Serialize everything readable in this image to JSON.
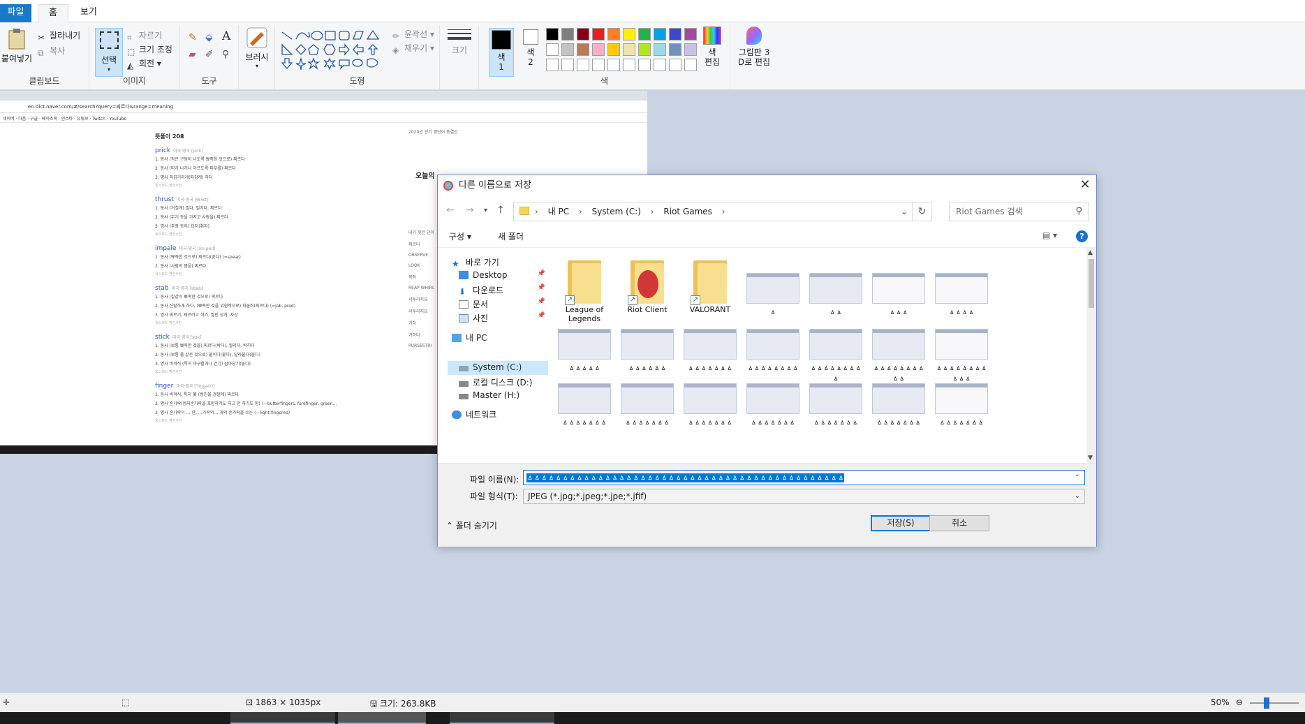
{
  "ribbon_tabs": {
    "file": "파일",
    "home": "홈",
    "view": "보기"
  },
  "clipboard": {
    "paste": "붙여넣기",
    "cut": "잘라내기",
    "copy": "복사",
    "label": "클립보드"
  },
  "image": {
    "select": "선택",
    "crop": "자르기",
    "resize": "크기 조정",
    "rotate": "회전",
    "label": "이미지"
  },
  "tools": {
    "label": "도구",
    "text_tool": "A"
  },
  "brushes": {
    "label": "브러시"
  },
  "shapes": {
    "outline": "윤곽선",
    "fill": "채우기",
    "label": "도형"
  },
  "size": {
    "label": "크기"
  },
  "colors": {
    "color1": "색\n1",
    "color2": "색\n2",
    "edit_colors": "색\n편집",
    "paint3d": "그림판 3\nD로 편집",
    "label": "색",
    "color1_value": "#000000",
    "color2_value": "#ffffff",
    "palette": [
      "#000000",
      "#7f7f7f",
      "#880015",
      "#ed1c24",
      "#ff7f27",
      "#fff200",
      "#22b14c",
      "#00a2e8",
      "#3f48cc",
      "#a349a4",
      "#ffffff",
      "#c3c3c3",
      "#b97a57",
      "#ffaec9",
      "#ffc90e",
      "#efe4b0",
      "#b5e61d",
      "#99d9ea",
      "#7092be",
      "#c8bfe7"
    ]
  },
  "screenshot_content": {
    "url": "en.dict.naver.com/#/search?query=찌르다&range=meaning",
    "bookmarks": "네이버 · 다음 · 구글 · 페이스북 · 인스타 · 유튜브 · Twitch · YouTube",
    "heading": "뜻풀이 208",
    "entries": [
      {
        "word": "prick",
        "meta": "미국·영국 [prɪk]",
        "defs": [
          "1. 동사 (작은 구멍이 나도록 뾰족한 것으로) 찌르다",
          "2. 동사 (따가 나거나 아프도록 피부를) 찌르다",
          "3. 명사 따끔거리게(따갑게) 하다"
        ],
        "src": "옥스퍼드 영한사전"
      },
      {
        "word": "thrust",
        "meta": "미국·영국 [θrʌst]",
        "defs": [
          "1. 동사 (거칠게) 밀다, 밀치다, 찌르다",
          "2. 동사 (무기 등을 가지고 사람을) 찌르다",
          "3. 명사 (주장 등의) 요지(취지)"
        ],
        "src": "옥스퍼드 영한사전"
      },
      {
        "word": "impale",
        "meta": "미국·영국 [ɪm peɪl]",
        "defs": [
          "1. 동사 (뾰족한 것으로) 찌르다(꽂다) (=spear)",
          "2. 동사 (사람의 몸을) 찌르다"
        ],
        "src": "옥스퍼드 영한사전"
      },
      {
        "word": "stab",
        "meta": "미국·영국 [stæb]",
        "defs": [
          "1. 동사 (칼같이 뾰족한 것으로) 찌르다",
          "2. 동사 신랄하게 하다, (뾰족한 것을 위협적으로) 휘둘러(찌르다) (=jab, prod)",
          "3. 명사 찌르기, 찌르려고 하기, 찔린 상처, 자상"
        ],
        "src": "옥스퍼드 영한사전"
      },
      {
        "word": "stick",
        "meta": "미국·영국 [stɪk]",
        "defs": [
          "1. 동사 (보통 뾰족한 것을) 찌르다(박다), 찔리다, 박히다",
          "2. 동사 (보통 풀 같은 것으로) 붙이다(붙다), 달라붙다(붙다)",
          "3. 명사 비격식 (특히 야구할거나 걷기) 잡아당기(놓다)"
        ],
        "src": "옥스퍼드 영한사전"
      },
      {
        "word": "finger",
        "meta": "미국·영국 [ˈfɪŋɡə(r)]",
        "defs": [
          "1. 동사 비격식, 특히 美 (범인을 경찰에) 찌르다",
          "2. 명사 손가락(엄지손가락을 포함하기도 하고 안 하기도 함) (—butterfingers, forefinger, green…",
          "3. 명사 손가락이 … 한, …가락의… 개의 손가락을 쓰는 (—light-fingered)"
        ],
        "src": "옥스퍼드 영한사전"
      }
    ],
    "right_panel": [
      "2020년 인기 영단어 총결산",
      "오늘의",
      "내가 찾은 단어",
      "찌르다",
      "OBSERVE",
      "LOOK",
      "목적",
      "REAP WHIRL",
      "서투리지요",
      "서투리지요",
      "가하",
      "가하다",
      "PURSESTRI"
    ]
  },
  "dialog": {
    "title": "다른 이름으로 저장",
    "close": "✕",
    "breadcrumb": [
      "내 PC",
      "System (C:)",
      "Riot Games"
    ],
    "search_placeholder": "Riot Games 검색",
    "organize": "구성 ▾",
    "new_folder": "새 폴더",
    "nav": {
      "quick_access": "바로 가기",
      "desktop": "Desktop",
      "downloads": "다운로드",
      "documents": "문서",
      "pictures": "사진",
      "this_pc": "내 PC",
      "system_c": "System (C:)",
      "local_d": "로컬 디스크 (D:)",
      "master_h": "Master (H:)",
      "network": "네트워크"
    },
    "folders": [
      "League of Legends",
      "Riot Client",
      "VALORANT"
    ],
    "thumb_labels": [
      "ㅿ",
      "ㅿㅿ",
      "ㅿㅿㅿ",
      "ㅿㅿㅿㅿ",
      "ㅿㅿㅿㅿㅿ",
      "ㅿㅿㅿㅿㅿㅿ",
      "ㅿㅿㅿㅿㅿㅿㅿ",
      "ㅿㅿㅿㅿㅿㅿㅿㅿ",
      "ㅿㅿㅿㅿㅿㅿㅿㅿㅿ",
      "ㅿㅿㅿㅿㅿㅿㅿㅿㅿㅿ",
      "ㅿㅿㅿㅿㅿㅿㅿㅿㅿㅿㅿ",
      "ㅿㅿㅿㅿㅿㅿㅿ",
      "ㅿㅿㅿㅿㅿㅿㅿ",
      "ㅿㅿㅿㅿㅿㅿㅿ",
      "ㅿㅿㅿㅿㅿㅿㅿ",
      "ㅿㅿㅿㅿㅿㅿㅿ",
      "ㅿㅿㅿㅿㅿㅿㅿ",
      "ㅿㅿㅿㅿㅿㅿㅿ"
    ],
    "file_name_label": "파일 이름(N):",
    "file_name_value": "ㅿㅿㅿㅿㅿㅿㅿㅿㅿㅿㅿㅿㅿㅿㅿㅿㅿㅿㅿㅿㅿㅿㅿㅿㅿㅿㅿㅿㅿㅿㅿㅿㅿㅿㅿㅿㅿㅿㅿㅿㅿㅿㅿㅿㅿ",
    "file_type_label": "파일 형식(T):",
    "file_type_value": "JPEG (*.jpg;*.jpeg;*.jpe;*.jfif)",
    "hide_folders": "폴더 숨기기",
    "save": "저장(S)",
    "cancel": "취소"
  },
  "statusbar": {
    "dimensions": "1863 × 1035px",
    "size": "크기: 263.8KB",
    "zoom": "50%"
  }
}
